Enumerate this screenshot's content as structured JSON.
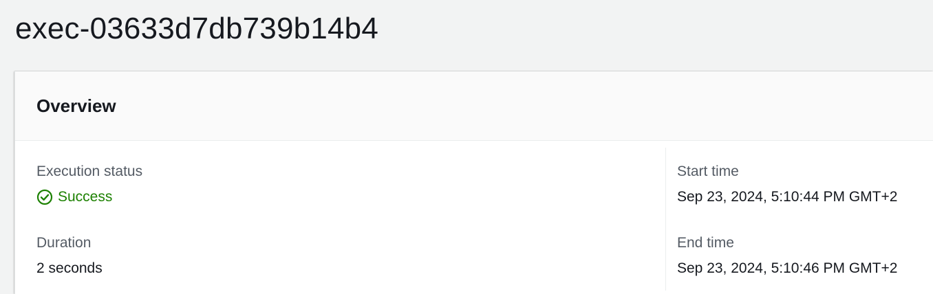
{
  "page": {
    "title": "exec-03633d7db739b14b4"
  },
  "overview": {
    "heading": "Overview",
    "execution_status": {
      "label": "Execution status",
      "value": "Success",
      "icon": "check-circle-icon",
      "color": "#1d8102"
    },
    "duration": {
      "label": "Duration",
      "value": "2 seconds"
    },
    "start_time": {
      "label": "Start time",
      "value": "Sep 23, 2024, 5:10:44 PM GMT+2"
    },
    "end_time": {
      "label": "End time",
      "value": "Sep 23, 2024, 5:10:46 PM GMT+2"
    }
  }
}
